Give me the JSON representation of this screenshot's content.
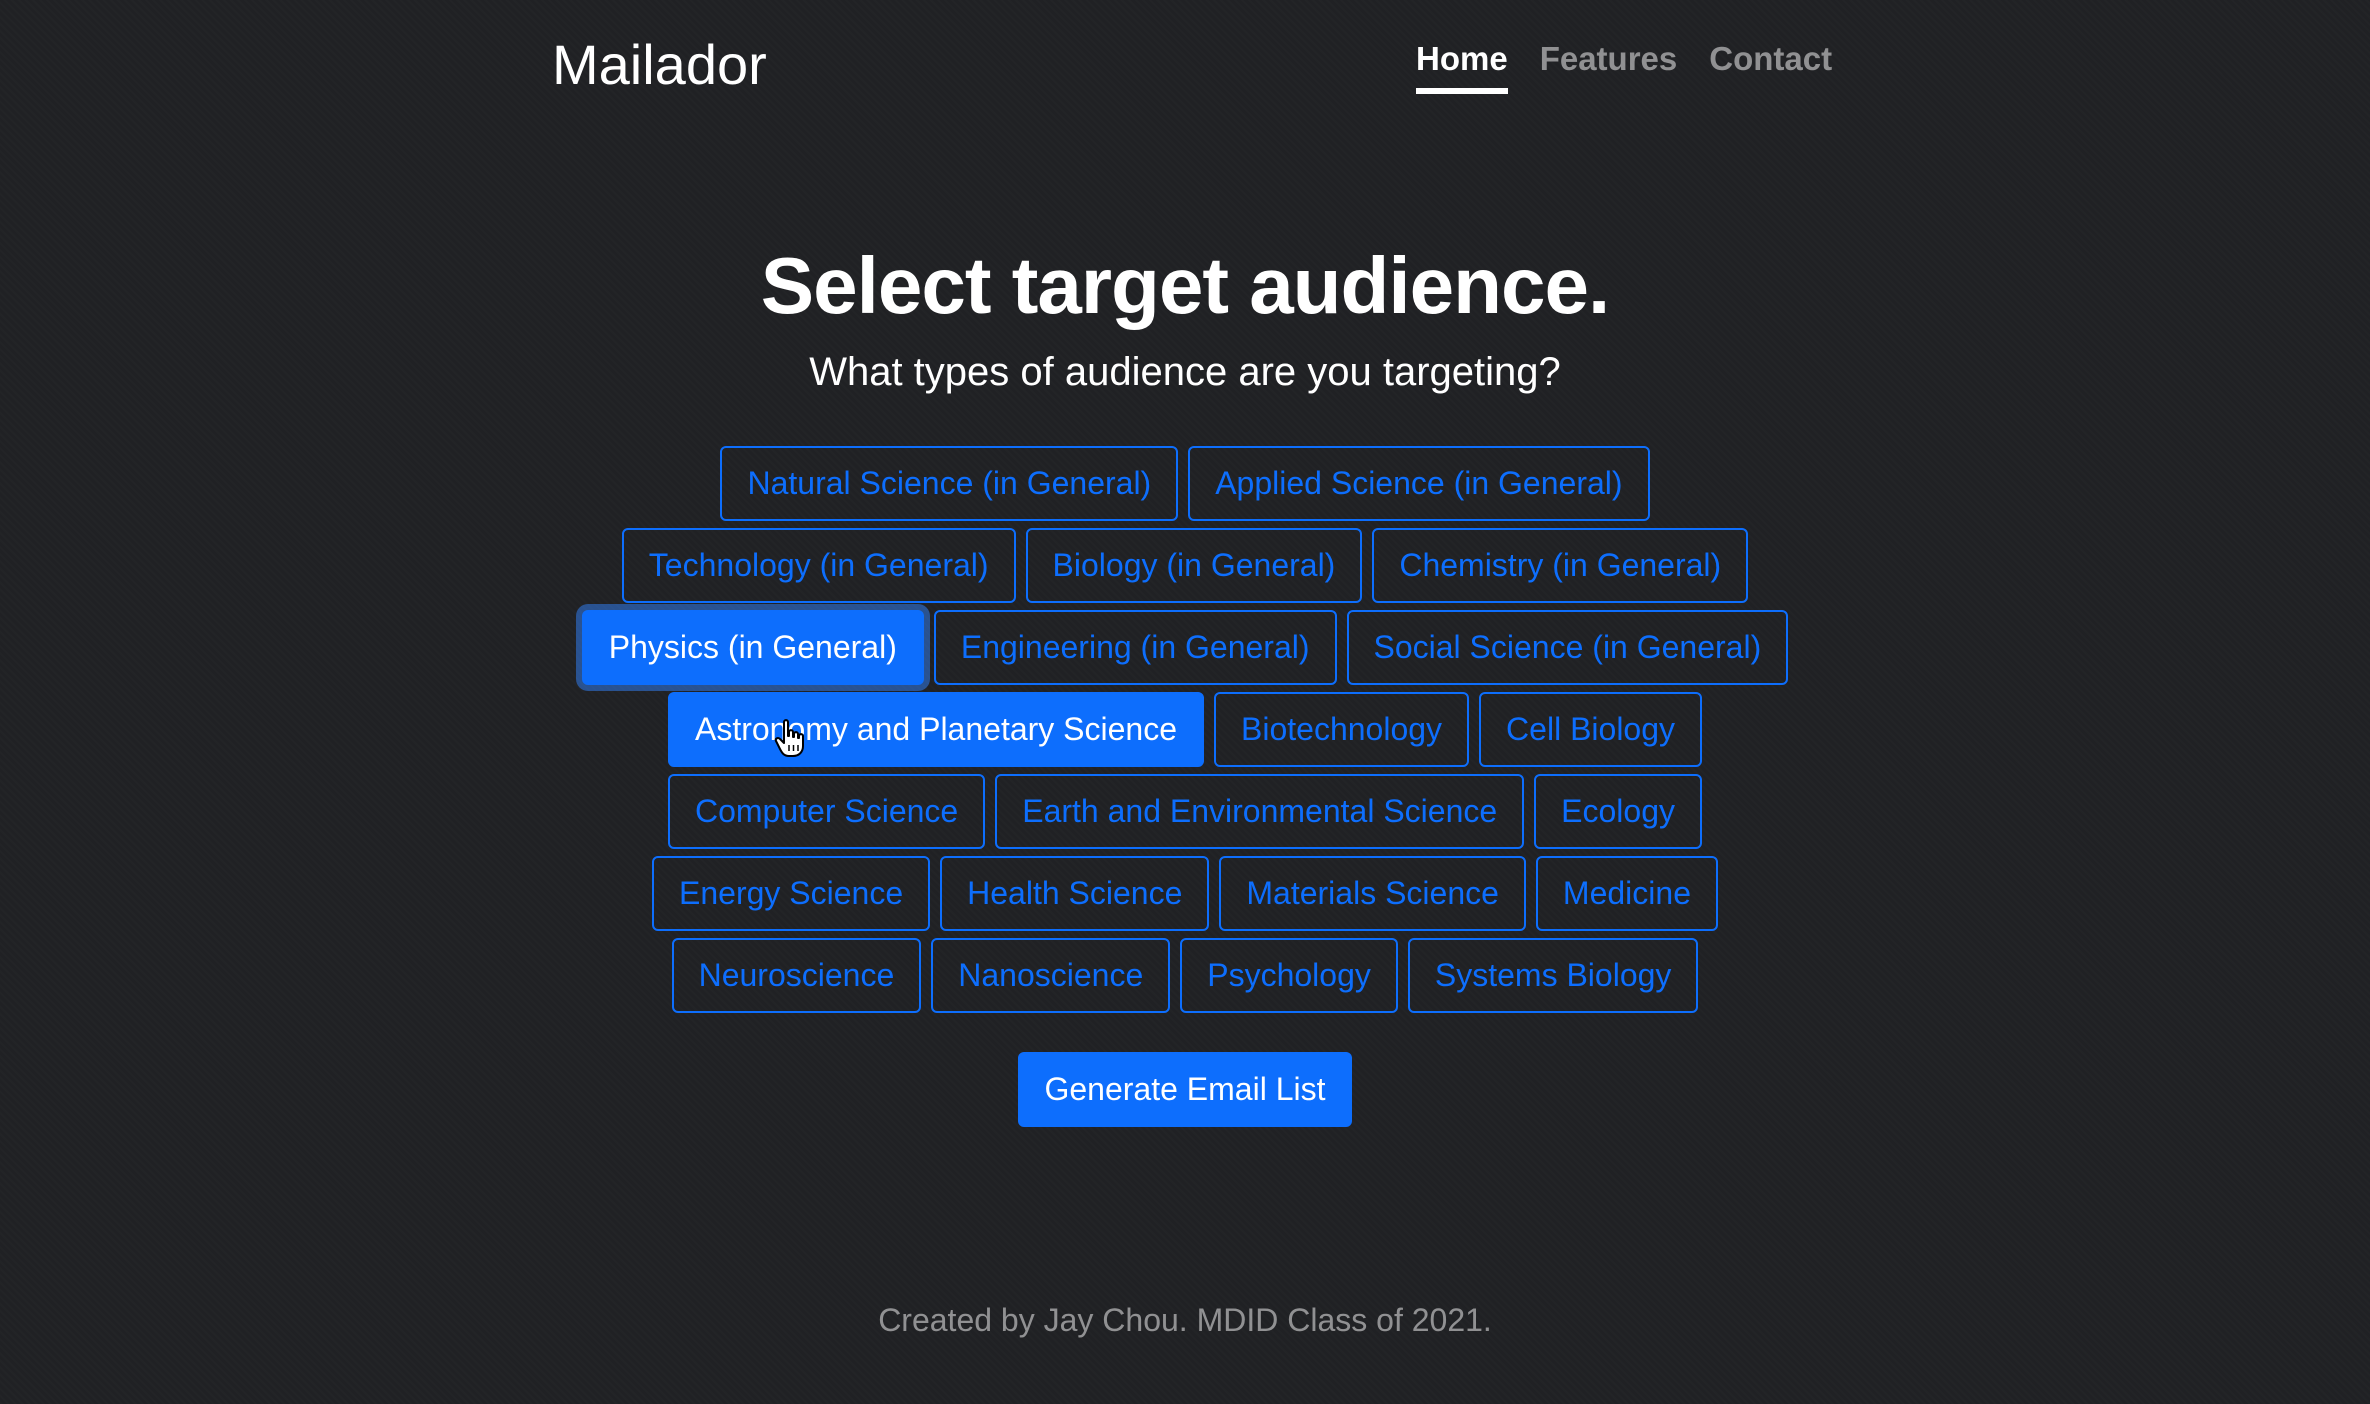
{
  "header": {
    "brand": "Mailador",
    "nav": [
      "Home",
      "Features",
      "Contact"
    ],
    "active_nav": "Home"
  },
  "hero": {
    "title": "Select target audience.",
    "subtitle": "What types of audience are you targeting?"
  },
  "audience": {
    "rows": [
      [
        "Natural Science (in General)",
        "Applied Science (in General)"
      ],
      [
        "Technology (in General)",
        "Biology (in General)",
        "Chemistry (in General)"
      ],
      [
        "Physics (in General)",
        "Engineering (in General)",
        "Social Science (in General)"
      ],
      [
        "Astronomy and Planetary Science",
        "Biotechnology",
        "Cell Biology"
      ],
      [
        "Computer Science",
        "Earth and Environmental Science",
        "Ecology"
      ],
      [
        "Energy Science",
        "Health Science",
        "Materials Science",
        "Medicine"
      ],
      [
        "Neuroscience",
        "Nanoscience",
        "Psychology",
        "Systems Biology"
      ]
    ],
    "selected": [
      "Physics (in General)",
      "Astronomy and Planetary Science"
    ],
    "focused": "Physics (in General)"
  },
  "actions": {
    "generate_label": "Generate Email List"
  },
  "footer": {
    "text": "Created by Jay Chou. MDID Class of 2021."
  },
  "colors": {
    "background": "#202124",
    "accent": "#0d6efd",
    "muted_text": "rgba(255,255,255,0.5)"
  },
  "icons": {
    "cursor": "hand-pointer-icon"
  }
}
